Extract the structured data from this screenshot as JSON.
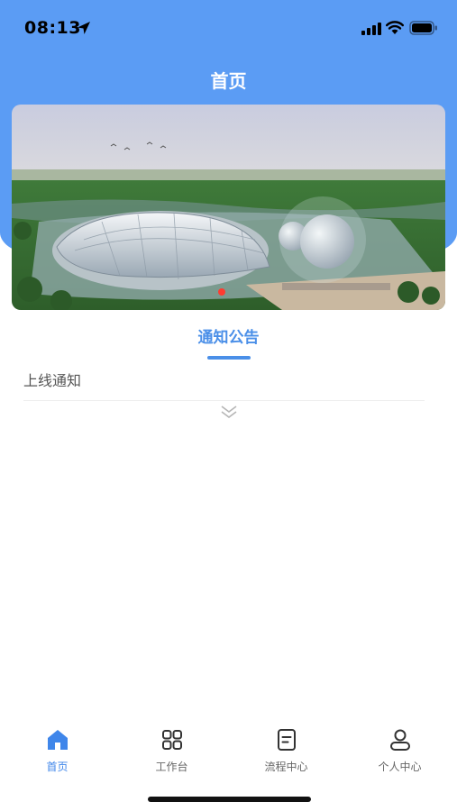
{
  "status_bar": {
    "time": "08:13"
  },
  "header": {
    "title": "首页"
  },
  "notice": {
    "tab_label": "通知公告",
    "items": [
      {
        "title": "上线通知"
      }
    ]
  },
  "tab_bar": {
    "items": [
      {
        "label": "首页",
        "icon": "home-icon",
        "active": true
      },
      {
        "label": "工作台",
        "icon": "grid-icon",
        "active": false
      },
      {
        "label": "流程中心",
        "icon": "document-icon",
        "active": false
      },
      {
        "label": "个人中心",
        "icon": "person-icon",
        "active": false
      }
    ]
  },
  "colors": {
    "accent": "#4a8fe8",
    "header_bg": "#5b9cf4",
    "indicator": "#ff3b30"
  }
}
